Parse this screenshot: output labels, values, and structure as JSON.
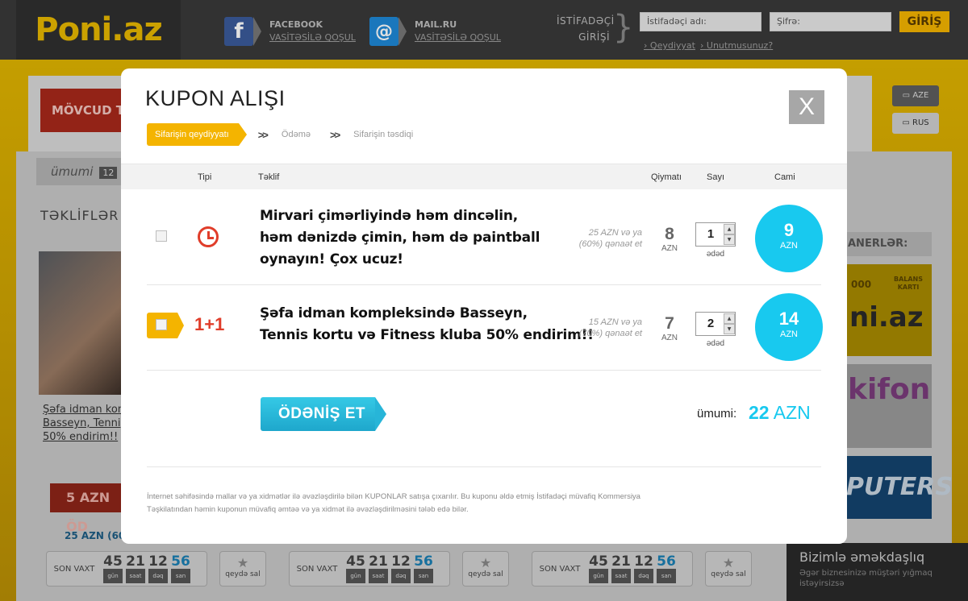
{
  "header": {
    "logo": "Poni.az",
    "facebook": {
      "title": "FACEBOOK",
      "link": "VASİTƏSİLƏ QOŞUL"
    },
    "mailru": {
      "title": "MAIL.RU",
      "link": "VASİTƏSİLƏ QOŞUL"
    },
    "user_label_1": "İSTİFADƏÇİ",
    "user_label_2": "GİRİŞİ",
    "username_placeholder": "İstifadəçi adı:",
    "password_placeholder": "Şifrə:",
    "login_button": "GİRİŞ",
    "register_link": "Qeydiyyat",
    "forgot_link": "Unutmusunuz?"
  },
  "background": {
    "current_tab": "MÖVCUD T",
    "total_label": "ümumi",
    "total_count": "12",
    "offers_heading": "TƏKLİFLƏR",
    "deal_text": [
      "Şəfa idman kom",
      "Basseyn, Tenni",
      "50% endirim!!"
    ],
    "price_button": "5 AZN ÖD",
    "old_price": "25 AZN (60%",
    "timer": {
      "label": "SON VAXT",
      "days": "45",
      "hours": "21",
      "minutes": "12",
      "seconds": "56",
      "days_unit": "gün",
      "hours_unit": "saat",
      "minutes_unit": "dəq",
      "seconds_unit": "san"
    },
    "save_label": "qeydə sal",
    "lang_aze": "AZE",
    "lang_rus": "RUS",
    "partners_heading": "ANERLƏR:",
    "ad1_line1": "000",
    "ad1_line2": "ni.az",
    "ad1_card": "BALANS KARTI",
    "ad2_text": "kifon",
    "ad3_text": "PUTERS",
    "coop_title": "Bizimlə əməkdaşlıq",
    "coop_text": "Əgər biznesinizə müştəri yığmaq istəyirsizsə"
  },
  "modal": {
    "title": "KUPON ALIŞI",
    "close_label": "X",
    "steps": [
      "Sifarişin qeydiyyatı",
      "Ödəmə",
      "Sifarişin təsdiqi"
    ],
    "step_separator": ">>",
    "columns": {
      "type": "Tipi",
      "offer": "Təklif",
      "price": "Qiymatı",
      "qty": "Sayı",
      "total": "Cami"
    },
    "rows": [
      {
        "type_icon": "clock-icon",
        "offer": [
          "Mirvari çimərliyində həm dincəlin,",
          "həm dənizdə çimin, həm də paintball",
          "oynayın! Çox ucuz!"
        ],
        "old_price_1": "25 AZN və ya",
        "old_price_2": "(60%) qənaət et",
        "price": "8",
        "price_unit": "AZN",
        "qty": "1",
        "qty_unit": "ədəd",
        "total": "9",
        "total_unit": "AZN"
      },
      {
        "type_label": "1+1",
        "offer": [
          "Şəfa idman kompleksində Basseyn,",
          "Tennis kortu və Fitness kluba 50% endirim!!"
        ],
        "old_price_1": "15 AZN və ya",
        "old_price_2": "(70%) qənaət et",
        "price": "7",
        "price_unit": "AZN",
        "qty": "2",
        "qty_unit": "ədəd",
        "total": "14",
        "total_unit": "AZN"
      }
    ],
    "pay_button": "ÖDƏNİŞ ET",
    "sum_label": "ümumi:",
    "sum_value": "22",
    "sum_unit": "AZN",
    "disclaimer_1": "İnternet səhifəsində mallar və ya xidmətlər ilə əvəzləşdirilə bilən KUPONLAR satışa çıxarılır. Bu kuponu əldə etmiş İstifadəçi müvafiq Kommersiya",
    "disclaimer_2": "Təşkilatından həmin kuponun müvafiq əmtəə və ya xidmət ilə əvəzləşdirilməsini tələb edə bilər."
  },
  "colors": {
    "accent": "#f4b400",
    "cyan": "#18c9ef",
    "red": "#e03d2a"
  }
}
